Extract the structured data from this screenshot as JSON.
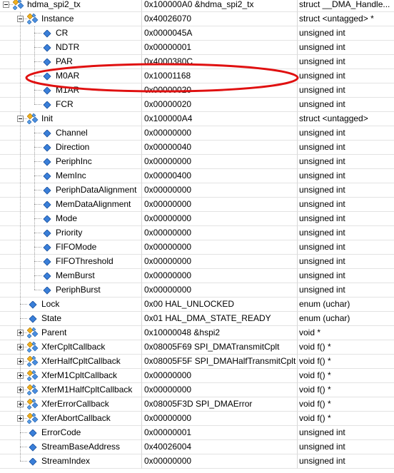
{
  "rows": [
    {
      "name": "hdma_spi2_tx",
      "value": "0x100000A0 &hdma_spi2_tx",
      "type": "struct __DMA_Handle...",
      "depth": 0,
      "exp": "minus",
      "icon": "struct-icon"
    },
    {
      "name": "Instance",
      "value": "0x40026070",
      "type": "struct <untagged> *",
      "depth": 1,
      "exp": "minus",
      "icon": "struct-icon"
    },
    {
      "name": "CR",
      "value": "0x0000045A",
      "type": "unsigned int",
      "depth": 2,
      "exp": "",
      "icon": "field-icon"
    },
    {
      "name": "NDTR",
      "value": "0x00000001",
      "type": "unsigned int",
      "depth": 2,
      "exp": "",
      "icon": "field-icon"
    },
    {
      "name": "PAR",
      "value": "0x4000380C",
      "type": "unsigned int",
      "depth": 2,
      "exp": "",
      "icon": "field-icon"
    },
    {
      "name": "M0AR",
      "value": "0x10001168",
      "type": "unsigned int",
      "depth": 2,
      "exp": "",
      "icon": "field-icon"
    },
    {
      "name": "M1AR",
      "value": "0x00000020",
      "type": "unsigned int",
      "depth": 2,
      "exp": "",
      "icon": "field-icon"
    },
    {
      "name": "FCR",
      "value": "0x00000020",
      "type": "unsigned int",
      "depth": 2,
      "exp": "",
      "icon": "field-icon"
    },
    {
      "name": "Init",
      "value": "0x100000A4",
      "type": "struct <untagged>",
      "depth": 1,
      "exp": "minus",
      "icon": "struct-icon"
    },
    {
      "name": "Channel",
      "value": "0x00000000",
      "type": "unsigned int",
      "depth": 2,
      "exp": "",
      "icon": "field-icon"
    },
    {
      "name": "Direction",
      "value": "0x00000040",
      "type": "unsigned int",
      "depth": 2,
      "exp": "",
      "icon": "field-icon"
    },
    {
      "name": "PeriphInc",
      "value": "0x00000000",
      "type": "unsigned int",
      "depth": 2,
      "exp": "",
      "icon": "field-icon"
    },
    {
      "name": "MemInc",
      "value": "0x00000400",
      "type": "unsigned int",
      "depth": 2,
      "exp": "",
      "icon": "field-icon"
    },
    {
      "name": "PeriphDataAlignment",
      "value": "0x00000000",
      "type": "unsigned int",
      "depth": 2,
      "exp": "",
      "icon": "field-icon"
    },
    {
      "name": "MemDataAlignment",
      "value": "0x00000000",
      "type": "unsigned int",
      "depth": 2,
      "exp": "",
      "icon": "field-icon"
    },
    {
      "name": "Mode",
      "value": "0x00000000",
      "type": "unsigned int",
      "depth": 2,
      "exp": "",
      "icon": "field-icon"
    },
    {
      "name": "Priority",
      "value": "0x00000000",
      "type": "unsigned int",
      "depth": 2,
      "exp": "",
      "icon": "field-icon"
    },
    {
      "name": "FIFOMode",
      "value": "0x00000000",
      "type": "unsigned int",
      "depth": 2,
      "exp": "",
      "icon": "field-icon"
    },
    {
      "name": "FIFOThreshold",
      "value": "0x00000000",
      "type": "unsigned int",
      "depth": 2,
      "exp": "",
      "icon": "field-icon"
    },
    {
      "name": "MemBurst",
      "value": "0x00000000",
      "type": "unsigned int",
      "depth": 2,
      "exp": "",
      "icon": "field-icon"
    },
    {
      "name": "PeriphBurst",
      "value": "0x00000000",
      "type": "unsigned int",
      "depth": 2,
      "exp": "",
      "icon": "field-icon"
    },
    {
      "name": "Lock",
      "value": "0x00 HAL_UNLOCKED",
      "type": "enum (uchar)",
      "depth": 1,
      "exp": "",
      "icon": "field-icon"
    },
    {
      "name": "State",
      "value": "0x01 HAL_DMA_STATE_READY",
      "type": "enum (uchar)",
      "depth": 1,
      "exp": "",
      "icon": "field-icon"
    },
    {
      "name": "Parent",
      "value": "0x10000048 &hspi2",
      "type": "void *",
      "depth": 1,
      "exp": "plus",
      "icon": "struct-icon"
    },
    {
      "name": "XferCpltCallback",
      "value": "0x08005F69 SPI_DMATransmitCplt",
      "type": "void f()  *",
      "depth": 1,
      "exp": "plus",
      "icon": "struct-icon"
    },
    {
      "name": "XferHalfCpltCallback",
      "value": "0x08005F5F SPI_DMAHalfTransmitCplt",
      "type": "void f()  *",
      "depth": 1,
      "exp": "plus",
      "icon": "struct-icon"
    },
    {
      "name": "XferM1CpltCallback",
      "value": "0x00000000",
      "type": "void f()  *",
      "depth": 1,
      "exp": "plus",
      "icon": "struct-icon"
    },
    {
      "name": "XferM1HalfCpltCallback",
      "value": "0x00000000",
      "type": "void f()  *",
      "depth": 1,
      "exp": "plus",
      "icon": "struct-icon"
    },
    {
      "name": "XferErrorCallback",
      "value": "0x08005F3D SPI_DMAError",
      "type": "void f()  *",
      "depth": 1,
      "exp": "plus",
      "icon": "struct-icon"
    },
    {
      "name": "XferAbortCallback",
      "value": "0x00000000",
      "type": "void f()  *",
      "depth": 1,
      "exp": "plus",
      "icon": "struct-icon"
    },
    {
      "name": "ErrorCode",
      "value": "0x00000001",
      "type": "unsigned int",
      "depth": 1,
      "exp": "",
      "icon": "field-icon"
    },
    {
      "name": "StreamBaseAddress",
      "value": "0x40026004",
      "type": "unsigned int",
      "depth": 1,
      "exp": "",
      "icon": "field-icon"
    },
    {
      "name": "StreamIndex",
      "value": "0x00000000",
      "type": "unsigned int",
      "depth": 1,
      "exp": "",
      "icon": "field-icon"
    }
  ],
  "annotation_color": "#e01010"
}
